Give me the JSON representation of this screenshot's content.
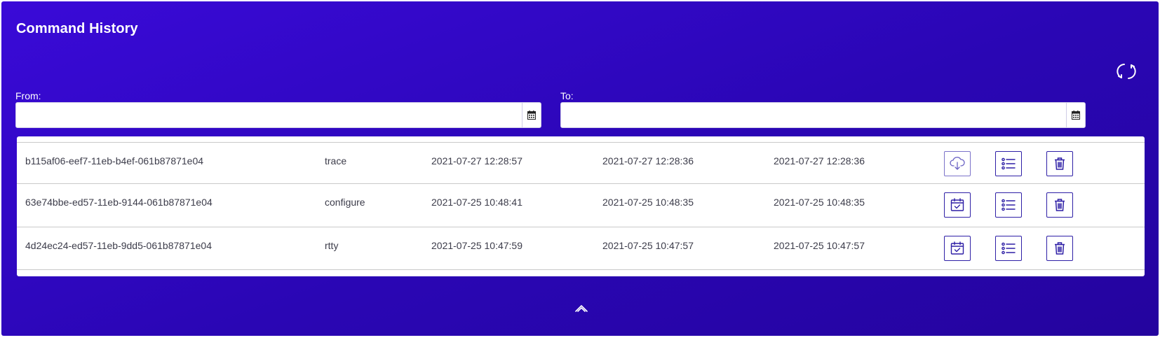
{
  "header": {
    "title": "Command History"
  },
  "filters": {
    "from_label": "From:",
    "from_value": "",
    "to_label": "To:",
    "to_value": ""
  },
  "icons": {
    "refresh": "refresh-icon",
    "calendar": "calendar-icon",
    "download": "cloud-download-icon",
    "scheduled": "calendar-check-icon",
    "details": "list-icon",
    "delete": "trash-icon",
    "collapse": "chevron-up-double-icon"
  },
  "colors": {
    "panel_bg": "#2f08c4",
    "accent": "#2e1fa6"
  },
  "rows": [
    {
      "uuid": "b115af06-eef7-11eb-b4ef-061b87871e04",
      "command": "trace",
      "time1": "2021-07-27 12:28:57",
      "time2": "2021-07-27 12:28:36",
      "time3": "2021-07-27 12:28:36",
      "primary_action": "download"
    },
    {
      "uuid": "63e74bbe-ed57-11eb-9144-061b87871e04",
      "command": "configure",
      "time1": "2021-07-25 10:48:41",
      "time2": "2021-07-25 10:48:35",
      "time3": "2021-07-25 10:48:35",
      "primary_action": "scheduled"
    },
    {
      "uuid": "4d24ec24-ed57-11eb-9dd5-061b87871e04",
      "command": "rtty",
      "time1": "2021-07-25 10:47:59",
      "time2": "2021-07-25 10:47:57",
      "time3": "2021-07-25 10:47:57",
      "primary_action": "scheduled"
    }
  ]
}
